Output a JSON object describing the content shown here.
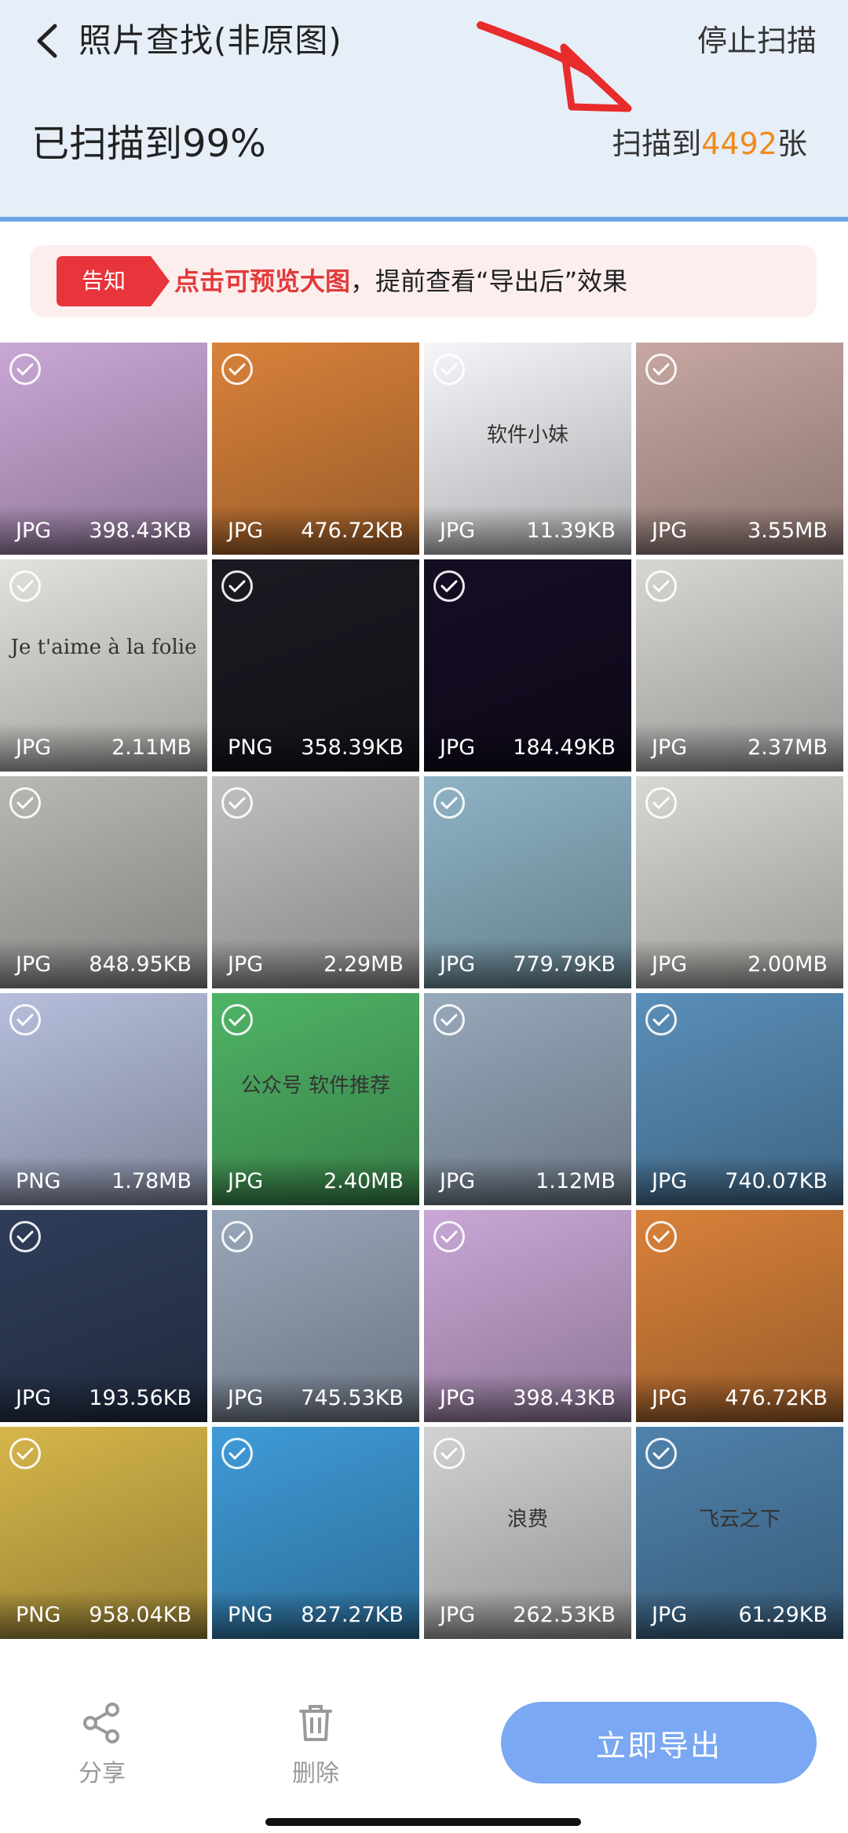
{
  "header": {
    "title": "照片查找(非原图)",
    "stop_label": "停止扫描",
    "progress_text": "已扫描到99%",
    "count_prefix": "扫描到",
    "count_value": "4492",
    "count_suffix": "张",
    "bg_color": "#e6eef7",
    "accent_color": "#f08a1c"
  },
  "notice": {
    "tag": "告知",
    "highlight": "点击可预览大图",
    "text": "，提前查看“导出后”效果"
  },
  "tiles": [
    {
      "format": "JPG",
      "size": "398.43KB",
      "bg": "#c9a7d6",
      "label": ""
    },
    {
      "format": "JPG",
      "size": "476.72KB",
      "bg": "#d9823a",
      "label": ""
    },
    {
      "format": "JPG",
      "size": "11.39KB",
      "bg": "#f4f6f9",
      "label": "软件小妹"
    },
    {
      "format": "JPG",
      "size": "3.55MB",
      "bg": "#c7a7a2",
      "label": ""
    },
    {
      "format": "JPG",
      "size": "2.11MB",
      "bg": "#e3e1de",
      "label": "Je t'aime à la folie"
    },
    {
      "format": "PNG",
      "size": "358.39KB",
      "bg": "#1a1a22",
      "label": ""
    },
    {
      "format": "JPG",
      "size": "184.49KB",
      "bg": "#150d24",
      "label": ""
    },
    {
      "format": "JPG",
      "size": "2.37MB",
      "bg": "#d7d6d3",
      "label": ""
    },
    {
      "format": "JPG",
      "size": "848.95KB",
      "bg": "#b9b8b5",
      "label": ""
    },
    {
      "format": "JPG",
      "size": "2.29MB",
      "bg": "#bfc0bf",
      "label": ""
    },
    {
      "format": "JPG",
      "size": "779.79KB",
      "bg": "#8fb4c6",
      "label": ""
    },
    {
      "format": "JPG",
      "size": "2.00MB",
      "bg": "#d9d7d3",
      "label": ""
    },
    {
      "format": "PNG",
      "size": "1.78MB",
      "bg": "#b6bedc",
      "label": ""
    },
    {
      "format": "JPG",
      "size": "2.40MB",
      "bg": "#4fb466",
      "label": "公众号 软件推荐"
    },
    {
      "format": "JPG",
      "size": "1.12MB",
      "bg": "#97a9bb",
      "label": ""
    },
    {
      "format": "JPG",
      "size": "740.07KB",
      "bg": "#5a8fb9",
      "label": ""
    },
    {
      "format": "JPG",
      "size": "193.56KB",
      "bg": "#2f3d5a",
      "label": ""
    },
    {
      "format": "JPG",
      "size": "745.53KB",
      "bg": "#9aa7ba",
      "label": ""
    },
    {
      "format": "JPG",
      "size": "398.43KB",
      "bg": "#c9a7d6",
      "label": ""
    },
    {
      "format": "JPG",
      "size": "476.72KB",
      "bg": "#d9823a",
      "label": ""
    },
    {
      "format": "PNG",
      "size": "958.04KB",
      "bg": "#d6b64a",
      "label": ""
    },
    {
      "format": "PNG",
      "size": "827.27KB",
      "bg": "#3f9bd8",
      "label": ""
    },
    {
      "format": "JPG",
      "size": "262.53KB",
      "bg": "#d2d2d2",
      "label": "浪费"
    },
    {
      "format": "JPG",
      "size": "61.29KB",
      "bg": "#4f82ac",
      "label": "飞云之下"
    }
  ],
  "bottom": {
    "share_label": "分享",
    "delete_label": "删除",
    "export_label": "立即导出"
  }
}
